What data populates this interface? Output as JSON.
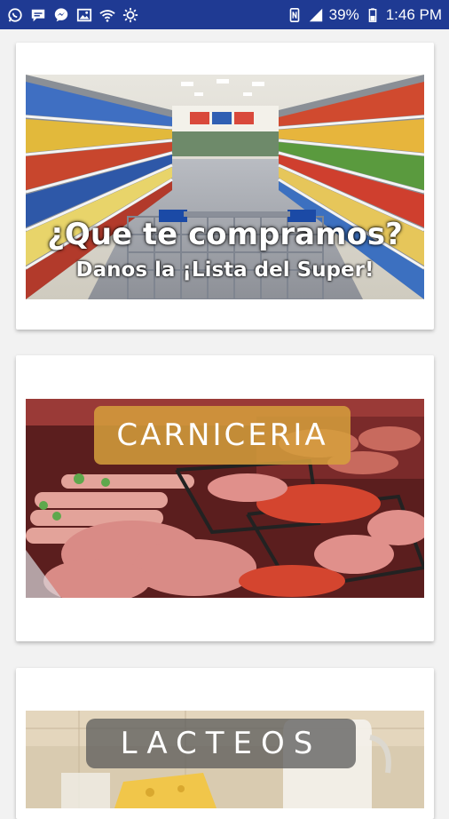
{
  "status_bar": {
    "battery_percent": "39%",
    "time": "1:46 PM",
    "left_icons": [
      "whatsapp-icon",
      "message-icon",
      "messenger-icon",
      "image-icon",
      "wifi-icon",
      "brightness-icon"
    ],
    "right_icons": [
      "nfc-icon",
      "signal-icon",
      "battery-icon"
    ],
    "bar_color": "#1f3a93"
  },
  "cards": [
    {
      "id": "supermarket",
      "title": "¿Que te compramos?",
      "subtitle": "Danos la ¡Lista del Super!"
    },
    {
      "id": "carniceria",
      "title": "CARNICERIA"
    },
    {
      "id": "lacteos",
      "title": "LACTEOS"
    }
  ]
}
